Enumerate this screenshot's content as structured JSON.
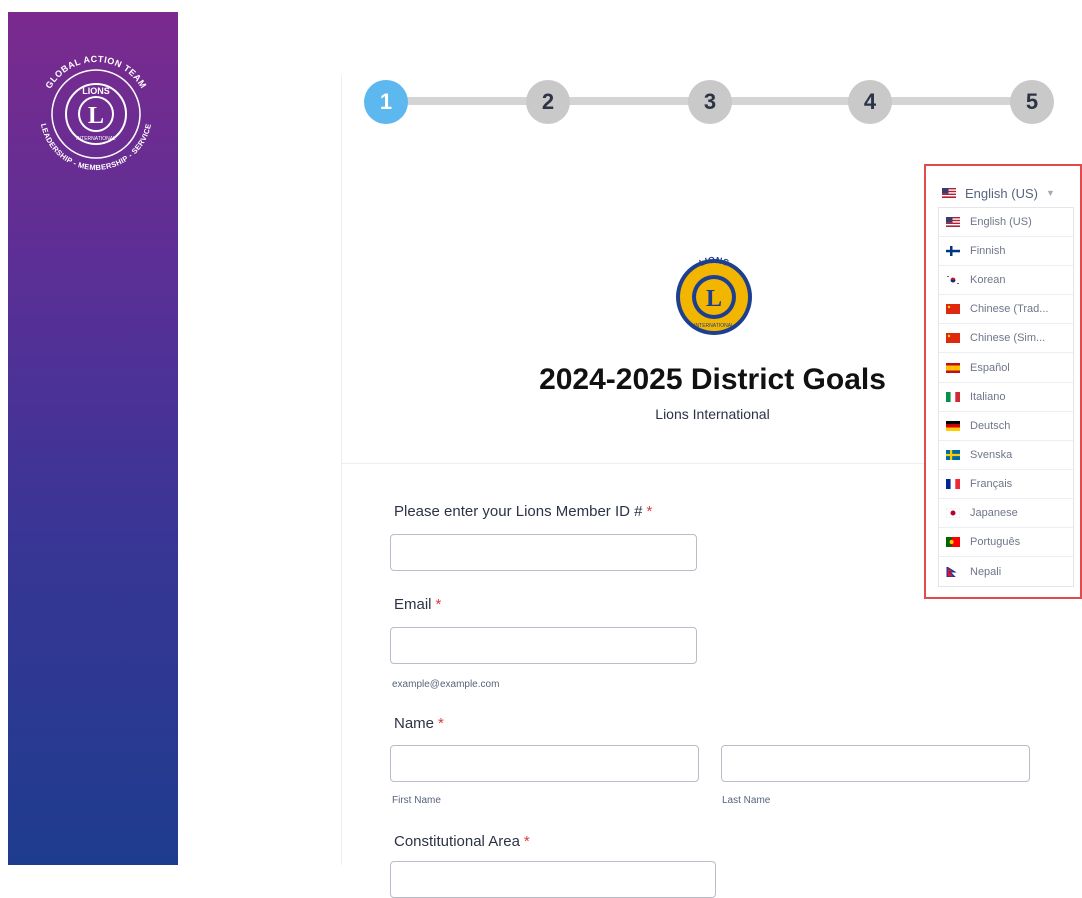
{
  "sidebar": {
    "seal_top_text": "GLOBAL ACTION TEAM",
    "seal_bottom_text": "LEADERSHIP - MEMBERSHIP - SERVICE",
    "seal_badge_text": "LIONS",
    "seal_badge_lower": "INTERNATIONAL",
    "colors": {
      "top": "#7b2a8e",
      "bottom": "#1e3c8e"
    }
  },
  "stepper": {
    "steps": [
      "1",
      "2",
      "3",
      "4",
      "5"
    ],
    "active_step": 1,
    "colors": {
      "active": "#5eb8f0",
      "inactive": "#c9c9c9"
    }
  },
  "header": {
    "logo_text_top": "LIONS",
    "logo_letter": "L",
    "logo_text_bottom": "INTERNATIONAL",
    "title": "2024-2025 District Goals",
    "subtitle": "Lions International"
  },
  "form": {
    "member_id": {
      "label": "Please enter your Lions Member ID #",
      "value": ""
    },
    "email": {
      "label": "Email",
      "value": "",
      "help": "example@example.com"
    },
    "name": {
      "label": "Name",
      "first_value": "",
      "last_value": "",
      "first_help": "First Name",
      "last_help": "Last Name"
    },
    "constitutional_area": {
      "label": "Constitutional Area"
    },
    "required_mark": "*"
  },
  "language": {
    "selected": "English (US)",
    "options": [
      {
        "label": "English (US)",
        "flag": "us-flag"
      },
      {
        "label": "Finnish",
        "flag": "finland-flag"
      },
      {
        "label": "Korean",
        "flag": "korea-flag"
      },
      {
        "label": "Chinese (Trad...",
        "flag": "china-flag"
      },
      {
        "label": "Chinese (Sim...",
        "flag": "china-flag"
      },
      {
        "label": "Español",
        "flag": "spain-flag"
      },
      {
        "label": "Italiano",
        "flag": "italy-flag"
      },
      {
        "label": "Deutsch",
        "flag": "germany-flag"
      },
      {
        "label": "Svenska",
        "flag": "sweden-flag"
      },
      {
        "label": "Français",
        "flag": "france-flag"
      },
      {
        "label": "Japanese",
        "flag": "japan-flag"
      },
      {
        "label": "Português",
        "flag": "portugal-flag"
      },
      {
        "label": "Nepali",
        "flag": "nepal-flag"
      }
    ],
    "highlight_color": "#e24b4b"
  }
}
